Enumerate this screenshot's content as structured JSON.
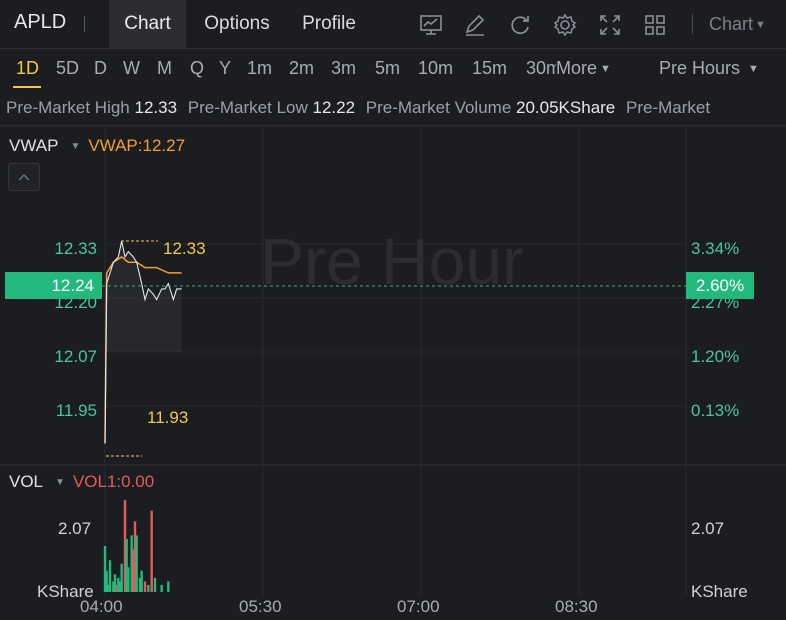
{
  "topbar": {
    "symbol": "APLD",
    "tabs": [
      {
        "label": "Chart",
        "active": true
      },
      {
        "label": "Options",
        "active": false
      },
      {
        "label": "Profile",
        "active": false
      }
    ],
    "tools": [
      "chart-line-icon",
      "pen-icon",
      "refresh-icon",
      "gear-icon",
      "fullscreen-icon",
      "grid-layout-icon"
    ],
    "chart_type_label": "Chart"
  },
  "periods": {
    "items": [
      "1D",
      "5D",
      "D",
      "W",
      "M",
      "Q",
      "Y",
      "1m",
      "2m",
      "3m",
      "5m",
      "10m",
      "15m",
      "30m"
    ],
    "active": "1D",
    "more_label": "More",
    "session_label": "Pre Hours"
  },
  "info": {
    "high_label": "Pre-Market High",
    "high_value": "12.33",
    "low_label": "Pre-Market Low",
    "low_value": "12.22",
    "volume_label": "Pre-Market Volume",
    "volume_value": "20.05KShare",
    "extra_label": "Pre-Market"
  },
  "main": {
    "indicator_name": "VWAP",
    "indicator_value": "VWAP:12.27",
    "watermark": "Pre Hour",
    "price_labels": [
      "12.33",
      "12.20",
      "12.07",
      "11.95"
    ],
    "pct_labels": [
      "3.34%",
      "2.27%",
      "1.20%",
      "0.13%"
    ],
    "current_price": "12.24",
    "current_pct": "2.60%",
    "high_marker": "12.33",
    "low_marker": "11.93"
  },
  "volume": {
    "indicator_name": "VOL",
    "indicator_value": "VOL1:0.00",
    "left_value": "2.07",
    "right_value": "2.07",
    "unit_left": "KShare",
    "unit_right": "KShare"
  },
  "time_axis": [
    "04:00",
    "05:30",
    "07:00",
    "08:30"
  ],
  "colors": {
    "up": "#21b97c",
    "down": "#e55a5a",
    "vwap": "#f0a030",
    "price_line": "#e6e7eb",
    "accent": "#f2c94c"
  },
  "chart_data": {
    "type": "line",
    "price_series": [
      {
        "t": "04:00",
        "price": 11.95
      },
      {
        "t": "04:01",
        "price": 12.25
      },
      {
        "t": "04:03",
        "price": 12.27
      },
      {
        "t": "04:05",
        "price": 12.29
      },
      {
        "t": "04:08",
        "price": 12.3
      },
      {
        "t": "04:10",
        "price": 12.33
      },
      {
        "t": "04:12",
        "price": 12.3
      },
      {
        "t": "04:14",
        "price": 12.31
      },
      {
        "t": "04:17",
        "price": 12.3
      },
      {
        "t": "04:19",
        "price": 12.29
      },
      {
        "t": "04:22",
        "price": 12.25
      },
      {
        "t": "04:24",
        "price": 12.22
      },
      {
        "t": "04:26",
        "price": 12.24
      },
      {
        "t": "04:29",
        "price": 12.23
      },
      {
        "t": "04:31",
        "price": 12.22
      },
      {
        "t": "04:34",
        "price": 12.24
      },
      {
        "t": "04:36",
        "price": 12.24
      },
      {
        "t": "04:38",
        "price": 12.25
      },
      {
        "t": "04:41",
        "price": 12.22
      },
      {
        "t": "04:43",
        "price": 12.24
      },
      {
        "t": "04:46",
        "price": 12.24
      }
    ],
    "vwap_series": [
      {
        "t": "04:00",
        "vwap": 11.95
      },
      {
        "t": "04:01",
        "vwap": 12.27
      },
      {
        "t": "04:05",
        "vwap": 12.29
      },
      {
        "t": "04:10",
        "vwap": 12.3
      },
      {
        "t": "04:14",
        "vwap": 12.29
      },
      {
        "t": "04:19",
        "vwap": 12.29
      },
      {
        "t": "04:24",
        "vwap": 12.28
      },
      {
        "t": "04:31",
        "vwap": 12.28
      },
      {
        "t": "04:38",
        "vwap": 12.27
      },
      {
        "t": "04:46",
        "vwap": 12.27
      }
    ],
    "volume_series": [
      {
        "t": "04:00",
        "vol": 1.3,
        "dir": "up"
      },
      {
        "t": "04:01",
        "vol": 0.6,
        "dir": "up"
      },
      {
        "t": "04:02",
        "vol": 0.2,
        "dir": "up"
      },
      {
        "t": "04:03",
        "vol": 0.9,
        "dir": "up"
      },
      {
        "t": "04:05",
        "vol": 0.3,
        "dir": "up"
      },
      {
        "t": "04:06",
        "vol": 0.5,
        "dir": "up"
      },
      {
        "t": "04:07",
        "vol": 0.2,
        "dir": "down"
      },
      {
        "t": "04:08",
        "vol": 0.4,
        "dir": "up"
      },
      {
        "t": "04:09",
        "vol": 0.3,
        "dir": "up"
      },
      {
        "t": "04:10",
        "vol": 0.8,
        "dir": "up"
      },
      {
        "t": "04:12",
        "vol": 2.6,
        "dir": "down"
      },
      {
        "t": "04:13",
        "vol": 1.5,
        "dir": "up"
      },
      {
        "t": "04:14",
        "vol": 0.7,
        "dir": "up"
      },
      {
        "t": "04:16",
        "vol": 1.6,
        "dir": "up"
      },
      {
        "t": "04:17",
        "vol": 1.2,
        "dir": "down"
      },
      {
        "t": "04:18",
        "vol": 2.0,
        "dir": "down"
      },
      {
        "t": "04:19",
        "vol": 1.6,
        "dir": "up"
      },
      {
        "t": "04:21",
        "vol": 0.4,
        "dir": "up"
      },
      {
        "t": "04:22",
        "vol": 0.6,
        "dir": "up"
      },
      {
        "t": "04:24",
        "vol": 0.3,
        "dir": "down"
      },
      {
        "t": "04:26",
        "vol": 0.2,
        "dir": "up"
      },
      {
        "t": "04:28",
        "vol": 2.3,
        "dir": "down"
      },
      {
        "t": "04:30",
        "vol": 0.4,
        "dir": "up"
      },
      {
        "t": "04:34",
        "vol": 0.2,
        "dir": "up"
      },
      {
        "t": "04:38",
        "vol": 0.3,
        "dir": "up"
      }
    ],
    "price_range": [
      11.9,
      12.36
    ],
    "volume_range": [
      0,
      2.6
    ],
    "time_range": [
      "04:00",
      "09:45"
    ],
    "grid": true
  }
}
